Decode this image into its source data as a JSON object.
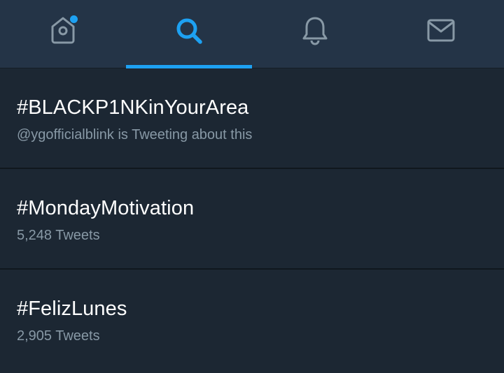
{
  "tabs": [
    {
      "id": "home",
      "icon": "home-icon",
      "active": false,
      "has_badge": true
    },
    {
      "id": "search",
      "icon": "search-icon",
      "active": true,
      "has_badge": false
    },
    {
      "id": "notifications",
      "icon": "bell-icon",
      "active": false,
      "has_badge": false
    },
    {
      "id": "messages",
      "icon": "envelope-icon",
      "active": false,
      "has_badge": false
    }
  ],
  "colors": {
    "accent": "#1da1f2",
    "background": "#1c2733",
    "tabbar": "#243447",
    "icon_inactive": "#8899a6",
    "text_primary": "#ffffff",
    "text_secondary": "#8899a6"
  },
  "trends": [
    {
      "name": "#BLACKP1NKinYourArea",
      "meta": "@ygofficialblink is Tweeting about this"
    },
    {
      "name": "#MondayMotivation",
      "meta": "5,248 Tweets"
    },
    {
      "name": "#FelizLunes",
      "meta": "2,905 Tweets"
    }
  ]
}
